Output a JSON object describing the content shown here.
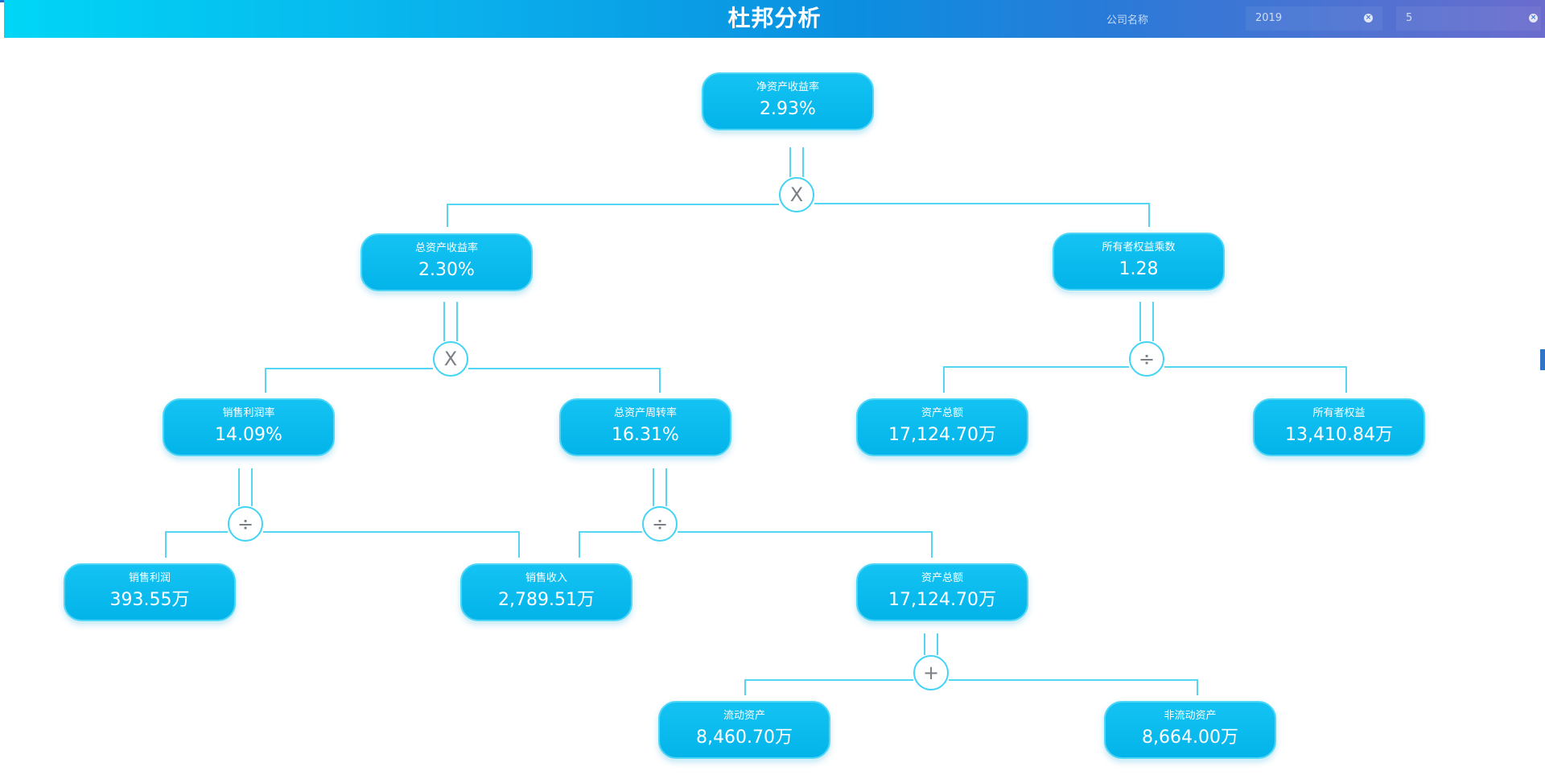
{
  "header": {
    "title": "杜邦分析",
    "company_label": "公司名称",
    "year": "2019",
    "month": "5"
  },
  "diagram": {
    "nodes": {
      "roe": {
        "label": "净资产收益率",
        "value": "2.93%"
      },
      "roa": {
        "label": "总资产收益率",
        "value": "2.30%"
      },
      "equity_multiplier": {
        "label": "所有者权益乘数",
        "value": "1.28"
      },
      "net_margin": {
        "label": "销售利润率",
        "value": "14.09%"
      },
      "asset_turnover": {
        "label": "总资产周转率",
        "value": "16.31%"
      },
      "total_assets_1": {
        "label": "资产总额",
        "value": "17,124.70万"
      },
      "owner_equity": {
        "label": "所有者权益",
        "value": "13,410.84万"
      },
      "sales_profit": {
        "label": "销售利润",
        "value": "393.55万"
      },
      "sales_revenue": {
        "label": "销售收入",
        "value": "2,789.51万"
      },
      "total_assets_2": {
        "label": "资产总额",
        "value": "17,124.70万"
      },
      "current_assets": {
        "label": "流动资产",
        "value": "8,460.70万"
      },
      "noncurrent_assets": {
        "label": "非流动资产",
        "value": "8,664.00万"
      }
    },
    "operators": {
      "op1": "X",
      "op2": "X",
      "op3": "÷",
      "op4": "÷",
      "op5": "÷",
      "op6": "+"
    },
    "link_color": "#55d7f3",
    "node_color": "#05b5eb"
  }
}
